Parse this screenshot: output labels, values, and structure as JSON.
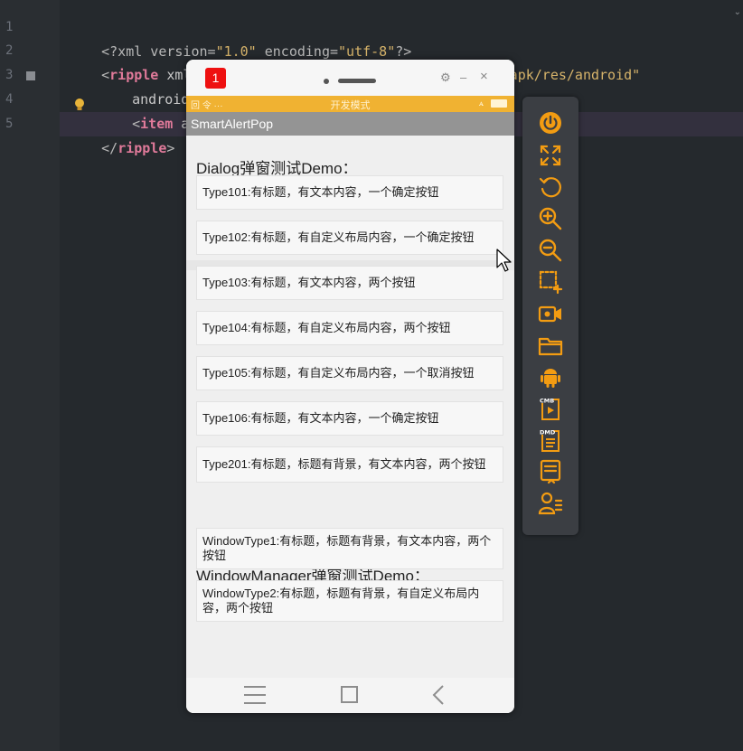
{
  "editor": {
    "line_numbers": [
      "1",
      "2",
      "3",
      "4",
      "5"
    ],
    "lines": {
      "l1": {
        "p1": "<?xml version=",
        "s1": "\"1.0\"",
        "p2": " encoding=",
        "s2": "\"utf-8\"",
        "p3": "?>"
      },
      "l2": {
        "p1": "<",
        "tag": "ripple",
        "attr": " xmlns:android=",
        "s1": "\"http://schemas.android.com/apk/res/android\""
      },
      "l3": {
        "text": "android:col"
      },
      "l4": {
        "p1": "<",
        "tag": "item",
        "attr": " andro",
        "tail": "\"/>"
      },
      "l5": {
        "p1": "</",
        "tag": "ripple",
        "p2": ">"
      }
    }
  },
  "emulator": {
    "badge": "1",
    "controls": {
      "settings": "⚙",
      "minimize": "–",
      "close": "×"
    },
    "status_bar": {
      "left": "回 令 ···",
      "center": "开发模式",
      "signal": "ꭺ"
    },
    "app_title": "SmartAlertPop",
    "sections": [
      {
        "title": "Dialog弹窗测试Demo：",
        "buttons": [
          "Type101:有标题，有文本内容，一个确定按钮",
          "Type102:有标题，有自定义布局内容，一个确定按钮",
          "Type103:有标题，有文本内容，两个按钮",
          "Type104:有标题，有自定义布局内容，两个按钮",
          "Type105:有标题，有自定义布局内容，一个取消按钮",
          "Type106:有标题，有文本内容，一个确定按钮",
          "Type201:有标题，标题有背景，有文本内容，两个按钮"
        ]
      },
      {
        "title": "WindowManager弹窗测试Demo：",
        "buttons": [
          "WindowType1:有标题，标题有背景，有文本内容，两个按钮",
          "WindowType2:有标题，标题有背景，有自定义布局内容，两个按钮"
        ]
      }
    ]
  },
  "tools": {
    "accent_color": "#f39c12",
    "items": [
      "power-icon",
      "fullscreen-icon",
      "rotate-icon",
      "zoom-in-icon",
      "zoom-out-icon",
      "screenshot-region-icon",
      "record-video-icon",
      "folder-icon",
      "android-icon",
      "cmb-script-icon",
      "dmd-script-icon",
      "log-icon",
      "user-settings-icon"
    ],
    "labels": {
      "cmb": "CMB",
      "dmd": "DMD"
    }
  },
  "colors": {
    "status_bar": "#f0b232",
    "app_bar": "#949494",
    "badge": "#ee1010"
  }
}
